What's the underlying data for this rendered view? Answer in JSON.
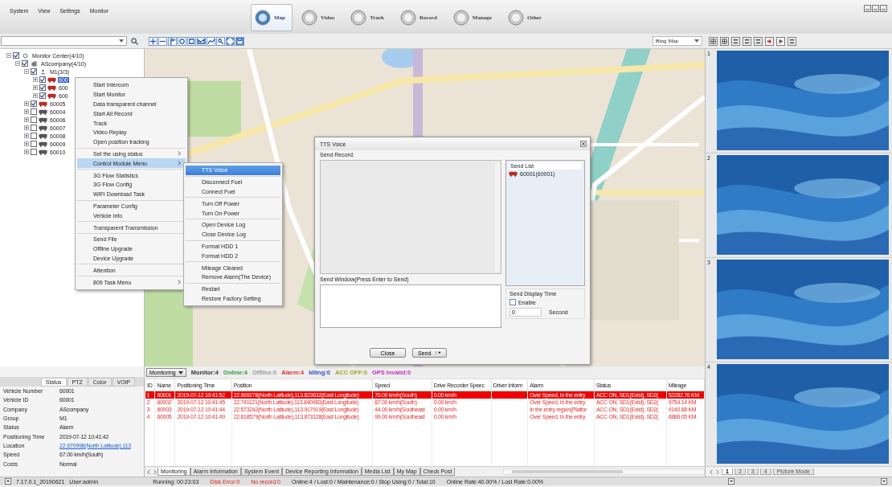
{
  "menu_bar": [
    "System",
    "View",
    "Settings",
    "Monitor"
  ],
  "nav_tabs": [
    {
      "label": "Map",
      "selected": true
    },
    {
      "label": "Video",
      "selected": false
    },
    {
      "label": "Track",
      "selected": false
    },
    {
      "label": "Record",
      "selected": false
    },
    {
      "label": "Manage",
      "selected": false
    },
    {
      "label": "Other",
      "selected": false
    }
  ],
  "map_type": "Bing Map",
  "tree": [
    {
      "label": "Monitor Center(4/10)",
      "kind": "center",
      "checked": true,
      "expanded": true,
      "selected": false,
      "children": [
        {
          "label": "AScompany(4/10)",
          "kind": "company",
          "checked": true,
          "expanded": true,
          "selected": false,
          "children": [
            {
              "label": "M1(3/3)",
              "kind": "group",
              "checked": true,
              "expanded": true,
              "selected": false,
              "children": [
                {
                  "label": "600",
                  "kind": "vehicle",
                  "checked": true,
                  "expanded": false,
                  "online": true,
                  "selected": true
                },
                {
                  "label": "600",
                  "kind": "vehicle",
                  "checked": true,
                  "expanded": false,
                  "online": true,
                  "selected": false
                },
                {
                  "label": "600",
                  "kind": "vehicle",
                  "checked": true,
                  "expanded": false,
                  "online": true,
                  "selected": false
                }
              ]
            },
            {
              "label": "60005",
              "kind": "vehicle",
              "checked": true,
              "expanded": false,
              "online": true,
              "selected": false
            },
            {
              "label": "60004",
              "kind": "vehicle",
              "checked": false,
              "expanded": false,
              "online": false,
              "selected": false
            },
            {
              "label": "60006",
              "kind": "vehicle",
              "checked": false,
              "expanded": false,
              "online": false,
              "selected": false
            },
            {
              "label": "60007",
              "kind": "vehicle",
              "checked": false,
              "expanded": false,
              "online": false,
              "selected": false
            },
            {
              "label": "60008",
              "kind": "vehicle",
              "checked": false,
              "expanded": false,
              "online": false,
              "selected": false
            },
            {
              "label": "60009",
              "kind": "vehicle",
              "checked": false,
              "expanded": false,
              "online": false,
              "selected": false
            },
            {
              "label": "60010",
              "kind": "vehicle",
              "checked": false,
              "expanded": false,
              "online": false,
              "selected": false
            }
          ]
        }
      ]
    }
  ],
  "context_menu": [
    [
      {
        "label": "Start Intercom",
        "submenu": false,
        "selected": false
      },
      {
        "label": "Start Monitor",
        "submenu": false,
        "selected": false
      },
      {
        "label": "Data transparent channel",
        "submenu": false,
        "selected": false
      },
      {
        "label": "Start All Record",
        "submenu": false,
        "selected": false
      },
      {
        "label": "Track",
        "submenu": false,
        "selected": false
      },
      {
        "label": "Video Replay",
        "submenu": false,
        "selected": false
      },
      {
        "label": "Open position tracking",
        "submenu": false,
        "selected": false
      }
    ],
    [
      {
        "label": "Set the using status",
        "submenu": true,
        "selected": false
      },
      {
        "label": "Control Module Menu",
        "submenu": true,
        "selected": true
      }
    ],
    [
      {
        "label": "3G Flow Statistics",
        "submenu": false,
        "selected": false
      },
      {
        "label": "3G Flow Config",
        "submenu": false,
        "selected": false
      },
      {
        "label": "WIFI Download Task",
        "submenu": false,
        "selected": false
      }
    ],
    [
      {
        "label": "Parameter Config",
        "submenu": false,
        "selected": false
      },
      {
        "label": "Vehicle Info",
        "submenu": false,
        "selected": false
      }
    ],
    [
      {
        "label": "Transparent Transmission",
        "submenu": false,
        "selected": false
      }
    ],
    [
      {
        "label": "Send File",
        "submenu": false,
        "selected": false
      },
      {
        "label": "Offline Upgrade",
        "submenu": false,
        "selected": false
      },
      {
        "label": "Device Upgrade",
        "submenu": false,
        "selected": false
      }
    ],
    [
      {
        "label": "Attention",
        "submenu": false,
        "selected": false
      }
    ],
    [
      {
        "label": "809 Task Menu",
        "submenu": true,
        "selected": false
      }
    ]
  ],
  "submenu": [
    [
      {
        "label": "TTS Voice",
        "selected": true
      }
    ],
    [
      {
        "label": "Disconnect Fuel",
        "selected": false
      },
      {
        "label": "Connect Fuel",
        "selected": false
      }
    ],
    [
      {
        "label": "Turn Off Power",
        "selected": false
      },
      {
        "label": "Turn On Power",
        "selected": false
      }
    ],
    [
      {
        "label": "Open Device Log",
        "selected": false
      },
      {
        "label": "Close Device Log",
        "selected": false
      }
    ],
    [
      {
        "label": "Format HDD 1",
        "selected": false
      },
      {
        "label": "Format HDD 2",
        "selected": false
      }
    ],
    [
      {
        "label": "Mileage Cleared",
        "selected": false
      },
      {
        "label": "Remove Alarm(The Device)",
        "selected": false
      }
    ],
    [
      {
        "label": "Restart",
        "selected": false
      },
      {
        "label": "Restore Factory Setting",
        "selected": false
      }
    ]
  ],
  "dialog": {
    "title": "TTS Voice",
    "record_label": "Send Record:",
    "window_label": "Send Window(Press Enter to Send)",
    "send_list_header": "Send List",
    "send_list": [
      {
        "label": "60001(60001)",
        "online": true
      }
    ],
    "display_time": {
      "title": "Send Display Time",
      "enable_label": "Enable",
      "enabled": false,
      "seconds": "0",
      "unit": "Second"
    },
    "buttons": [
      "Close",
      "Send"
    ]
  },
  "video_panes": [
    "1",
    "2",
    "3",
    "4"
  ],
  "picture_tabs": [
    {
      "label": "1",
      "selected": true
    },
    {
      "label": "2",
      "selected": false
    },
    {
      "label": "3",
      "selected": false
    },
    {
      "label": "4",
      "selected": false
    },
    {
      "label": "Picture Mode",
      "selected": false
    }
  ],
  "info_tabs": [
    {
      "label": "Status",
      "selected": true
    },
    {
      "label": "PTZ",
      "selected": false
    },
    {
      "label": "Color",
      "selected": false
    },
    {
      "label": "VOIP",
      "selected": false
    }
  ],
  "info": [
    {
      "label": "Vehicle Number",
      "value": "60001",
      "kind": "text"
    },
    {
      "label": "Vehicle ID",
      "value": "60001",
      "kind": "text"
    },
    {
      "label": "Company",
      "value": "AScompany",
      "kind": "text"
    },
    {
      "label": "Group",
      "value": "M1",
      "kind": "text"
    },
    {
      "label": "Status",
      "value": "Alarm",
      "kind": "text"
    },
    {
      "label": "Positioning Time",
      "value": "2019-07-12 10:41:42",
      "kind": "text"
    },
    {
      "label": "Location",
      "value": "22.670998(North Latitude),113",
      "kind": "link"
    },
    {
      "label": "Speed",
      "value": "67.00 km/h(South)",
      "kind": "text"
    },
    {
      "label": "Costs",
      "value": "Normal",
      "kind": "text"
    }
  ],
  "monitor_mode": "Monitoring",
  "counters": [
    {
      "label": "Monitor:4",
      "color": "#333333"
    },
    {
      "label": "Online:4",
      "color": "#2e9a2e"
    },
    {
      "label": "Offline:0",
      "color": "#9a9a9a"
    },
    {
      "label": "Alarm:4",
      "color": "#e23030"
    },
    {
      "label": "Idling:0",
      "color": "#2f4fc0"
    },
    {
      "label": "ACC OFF:0",
      "color": "#a5a520"
    },
    {
      "label": "GPS Invalid:0",
      "color": "#c030c0"
    }
  ],
  "table": {
    "columns": [
      "ID",
      "Name",
      "Positioning Time",
      "Position",
      "Speed",
      "Drive Recorder Speec",
      "Driver Inform",
      "Alarm",
      "Status",
      "Mileage"
    ],
    "rows": [
      {
        "selected": true,
        "alarm": true,
        "cells": [
          "1",
          "60001",
          "2019-07-12 10:41:52",
          "22.669278(North Latitude),113.823632(East Longitude)",
          "70.00 km/h(South)",
          "0.00 km/h",
          "",
          "Over Speed, In the entry",
          "ACC ON, SD1(Exist), SD2(",
          "52282.76 KM"
        ]
      },
      {
        "selected": false,
        "alarm": true,
        "cells": [
          "2",
          "60002",
          "2019-07-12 10:41:45",
          "22.741121(North Latitude),113.840983(East Longitude)",
          "87.00 km/h(South)",
          "0.00 km/h",
          "",
          "Over Speed, In the entry",
          "ACC ON, SD1(Exist), SD2(",
          "9754.14 KM"
        ]
      },
      {
        "selected": false,
        "alarm": true,
        "cells": [
          "3",
          "60003",
          "2019-07-12 10:41:44",
          "22.573242(North Latitude),113.917919(East Longitude)",
          "44.00 km/h(Southeast",
          "0.00 km/h",
          "",
          "In the entry region(Platfor",
          "ACC ON, SD1(Exist), SD2(",
          "9140.88 KM"
        ]
      },
      {
        "selected": false,
        "alarm": true,
        "cells": [
          "4",
          "60005",
          "2019-07-12 10:41:49",
          "22.618579(North Latitude),113.873128(East Longitude)",
          "99.00 km/h(Southeast",
          "0.00 km/h",
          "",
          "Over Speed, In the entry",
          "ACC ON, SD1(Exist), SD2(",
          "6886.05 KM"
        ]
      }
    ]
  },
  "bottom_tabs": [
    {
      "label": "Monitoring",
      "selected": true
    },
    {
      "label": "Alarm Information",
      "selected": false
    },
    {
      "label": "System Event",
      "selected": false
    },
    {
      "label": "Device Reporting Information",
      "selected": false
    },
    {
      "label": "Media List",
      "selected": false
    },
    {
      "label": "My Map",
      "selected": false
    },
    {
      "label": "Check Post",
      "selected": false
    }
  ],
  "status_bar": {
    "version": "7.17.0.1_20190621",
    "user": "User:admin",
    "items": [
      {
        "label": "Running: 00:23:03",
        "warning": false
      },
      {
        "label": "Disk Error:0",
        "warning": true
      },
      {
        "label": "No record:0",
        "warning": true
      },
      {
        "label": "Online:4 / Lost:0 / Maintenance:0 / Stop Using:0 / Total:10",
        "warning": false
      },
      {
        "label": "Online Rate:40.00% / Lost Rate:0.00%",
        "warning": false
      }
    ]
  }
}
